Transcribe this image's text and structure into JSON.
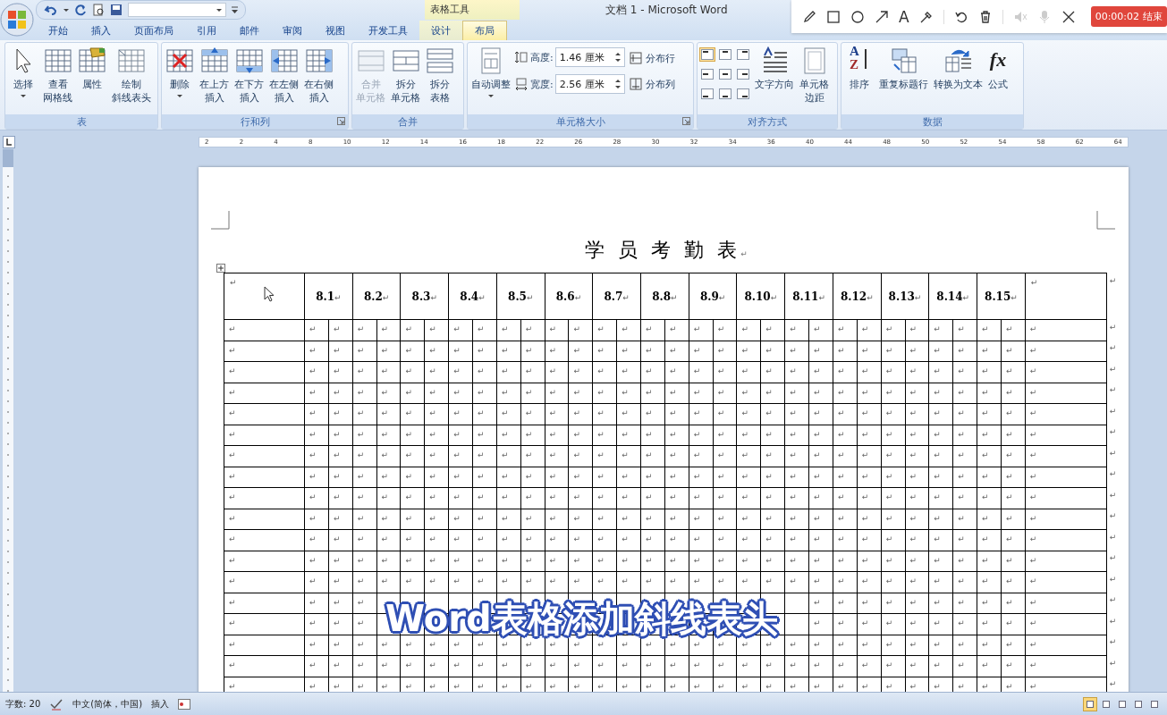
{
  "title_bar": {
    "context_label": "表格工具",
    "title": "文档 1 - Microsoft Word"
  },
  "tabs": [
    {
      "label": "开始",
      "selected": false
    },
    {
      "label": "插入",
      "selected": false
    },
    {
      "label": "页面布局",
      "selected": false
    },
    {
      "label": "引用",
      "selected": false
    },
    {
      "label": "邮件",
      "selected": false
    },
    {
      "label": "审阅",
      "selected": false
    },
    {
      "label": "视图",
      "selected": false
    },
    {
      "label": "开发工具",
      "selected": false
    },
    {
      "label": "设计",
      "selected": false
    },
    {
      "label": "布局",
      "selected": true
    }
  ],
  "ribbon": {
    "groups": [
      {
        "label": "表",
        "launcher": false,
        "items": [
          {
            "kind": "large",
            "lines": [
              "选择"
            ],
            "dropdown": true,
            "disabled": false
          },
          {
            "kind": "large",
            "lines": [
              "查看",
              "网格线"
            ],
            "dropdown": false,
            "disabled": false
          },
          {
            "kind": "large",
            "lines": [
              "属性"
            ],
            "dropdown": false,
            "disabled": false
          },
          {
            "kind": "large",
            "lines": [
              "绘制",
              "斜线表头"
            ],
            "dropdown": false,
            "disabled": false
          }
        ]
      },
      {
        "label": "行和列",
        "launcher": true,
        "items": [
          {
            "kind": "large",
            "lines": [
              "删除"
            ],
            "dropdown": true,
            "disabled": false
          },
          {
            "kind": "large",
            "lines": [
              "在上方",
              "插入"
            ],
            "dropdown": false,
            "disabled": false
          },
          {
            "kind": "large",
            "lines": [
              "在下方",
              "插入"
            ],
            "dropdown": false,
            "disabled": false
          },
          {
            "kind": "large",
            "lines": [
              "在左侧",
              "插入"
            ],
            "dropdown": false,
            "disabled": false
          },
          {
            "kind": "large",
            "lines": [
              "在右侧",
              "插入"
            ],
            "dropdown": false,
            "disabled": false
          }
        ]
      },
      {
        "label": "合并",
        "launcher": false,
        "items": [
          {
            "kind": "large",
            "lines": [
              "合并",
              "单元格"
            ],
            "dropdown": false,
            "disabled": true
          },
          {
            "kind": "large",
            "lines": [
              "拆分",
              "单元格"
            ],
            "dropdown": false,
            "disabled": false
          },
          {
            "kind": "large",
            "lines": [
              "拆分",
              "表格"
            ],
            "dropdown": false,
            "disabled": false
          }
        ]
      },
      {
        "label": "单元格大小",
        "launcher": true,
        "items": [
          {
            "kind": "large",
            "lines": [
              "自动调整"
            ],
            "dropdown": true,
            "disabled": false
          },
          {
            "kind": "size_fields",
            "fields": [
              {
                "label": "高度:",
                "value": "1.46 厘米"
              },
              {
                "label": "宽度:",
                "value": "2.56 厘米"
              }
            ]
          },
          {
            "kind": "small_stack",
            "buttons": [
              {
                "label": "分布行"
              },
              {
                "label": "分布列"
              }
            ]
          }
        ]
      },
      {
        "label": "对齐方式",
        "launcher": false,
        "items": [
          {
            "kind": "align_grid",
            "cells": [
              {
                "selected": true
              },
              {
                "selected": false
              },
              {
                "selected": false
              },
              {
                "selected": false
              },
              {
                "selected": false
              },
              {
                "selected": false
              },
              {
                "selected": false
              },
              {
                "selected": false
              },
              {
                "selected": false
              }
            ]
          },
          {
            "kind": "large",
            "lines": [
              "文字方向"
            ],
            "dropdown": false,
            "disabled": false
          },
          {
            "kind": "large",
            "lines": [
              "单元格",
              "边距"
            ],
            "dropdown": false,
            "disabled": false
          }
        ]
      },
      {
        "label": "数据",
        "launcher": false,
        "items": [
          {
            "kind": "large",
            "lines": [
              "排序"
            ],
            "glyph": [
              "A",
              "Z"
            ],
            "dropdown": false,
            "disabled": false
          },
          {
            "kind": "large",
            "lines": [
              "重复标题行"
            ],
            "dropdown": false,
            "disabled": false
          },
          {
            "kind": "large",
            "lines": [
              "转换为文本"
            ],
            "dropdown": false,
            "disabled": false
          },
          {
            "kind": "large",
            "lines": [
              "公式"
            ],
            "glyph": "fx",
            "dropdown": false,
            "disabled": false
          }
        ]
      }
    ]
  },
  "recorder": {
    "text_tool": "A",
    "timer": "00:00:02 结束"
  },
  "ruler": {
    "numbers": [
      "2",
      "2",
      "4",
      "8",
      "10",
      "12",
      "14",
      "16",
      "18",
      "22",
      "26",
      "28",
      "30",
      "32",
      "34",
      "36",
      "40",
      "44",
      "48",
      "50",
      "52",
      "54",
      "58",
      "62",
      "64"
    ]
  },
  "document": {
    "title": "学 员 考 勤 表",
    "title_mark": "↵",
    "table": {
      "header": {
        "corner": "↵",
        "dates": [
          {
            "text": "8.1",
            "mark": "↵"
          },
          {
            "text": "8.2",
            "mark": "↵"
          },
          {
            "text": "8.3",
            "mark": "↵"
          },
          {
            "text": "8.4",
            "mark": "↵"
          },
          {
            "text": "8.5",
            "mark": "↵"
          },
          {
            "text": "8.6",
            "mark": "↵"
          },
          {
            "text": "8.7",
            "mark": "↵"
          },
          {
            "text": "8.8",
            "mark": "↵"
          },
          {
            "text": "8.9",
            "mark": "↵"
          },
          {
            "text": "8.10",
            "mark": "↵"
          },
          {
            "text": "8.11",
            "mark": "↵"
          },
          {
            "text": "8.12",
            "mark": "↵"
          },
          {
            "text": "8.13",
            "mark": "↵"
          },
          {
            "text": "8.14",
            "mark": "↵"
          },
          {
            "text": "8.15",
            "mark": "↵"
          }
        ],
        "last": "↵",
        "end": "↵"
      },
      "rows": [
        [
          "↵",
          "↵",
          "↵",
          "↵",
          "↵",
          "↵",
          "↵",
          "↵",
          "↵",
          "↵",
          "↵",
          "↵",
          "↵",
          "↵",
          "↵",
          "↵",
          "↵",
          "↵",
          "↵",
          "↵",
          "↵",
          "↵",
          "↵",
          "↵",
          "↵",
          "↵",
          "↵",
          "↵",
          "↵",
          "↵",
          "↵",
          "↵",
          "↵"
        ],
        [
          "↵",
          "↵",
          "↵",
          "↵",
          "↵",
          "↵",
          "↵",
          "↵",
          "↵",
          "↵",
          "↵",
          "↵",
          "↵",
          "↵",
          "↵",
          "↵",
          "↵",
          "↵",
          "↵",
          "↵",
          "↵",
          "↵",
          "↵",
          "↵",
          "↵",
          "↵",
          "↵",
          "↵",
          "↵",
          "↵",
          "↵",
          "↵",
          "↵"
        ],
        [
          "↵",
          "↵",
          "↵",
          "↵",
          "↵",
          "↵",
          "↵",
          "↵",
          "↵",
          "↵",
          "↵",
          "↵",
          "↵",
          "↵",
          "↵",
          "↵",
          "↵",
          "↵",
          "↵",
          "↵",
          "↵",
          "↵",
          "↵",
          "↵",
          "↵",
          "↵",
          "↵",
          "↵",
          "↵",
          "↵",
          "↵",
          "↵",
          "↵"
        ],
        [
          "↵",
          "↵",
          "↵",
          "↵",
          "↵",
          "↵",
          "↵",
          "↵",
          "↵",
          "↵",
          "↵",
          "↵",
          "↵",
          "↵",
          "↵",
          "↵",
          "↵",
          "↵",
          "↵",
          "↵",
          "↵",
          "↵",
          "↵",
          "↵",
          "↵",
          "↵",
          "↵",
          "↵",
          "↵",
          "↵",
          "↵",
          "↵",
          "↵"
        ],
        [
          "↵",
          "↵",
          "↵",
          "↵",
          "↵",
          "↵",
          "↵",
          "↵",
          "↵",
          "↵",
          "↵",
          "↵",
          "↵",
          "↵",
          "↵",
          "↵",
          "↵",
          "↵",
          "↵",
          "↵",
          "↵",
          "↵",
          "↵",
          "↵",
          "↵",
          "↵",
          "↵",
          "↵",
          "↵",
          "↵",
          "↵",
          "↵",
          "↵"
        ],
        [
          "↵",
          "↵",
          "↵",
          "↵",
          "↵",
          "↵",
          "↵",
          "↵",
          "↵",
          "↵",
          "↵",
          "↵",
          "↵",
          "↵",
          "↵",
          "↵",
          "↵",
          "↵",
          "↵",
          "↵",
          "↵",
          "↵",
          "↵",
          "↵",
          "↵",
          "↵",
          "↵",
          "↵",
          "↵",
          "↵",
          "↵",
          "↵",
          "↵"
        ],
        [
          "↵",
          "↵",
          "↵",
          "↵",
          "↵",
          "↵",
          "↵",
          "↵",
          "↵",
          "↵",
          "↵",
          "↵",
          "↵",
          "↵",
          "↵",
          "↵",
          "↵",
          "↵",
          "↵",
          "↵",
          "↵",
          "↵",
          "↵",
          "↵",
          "↵",
          "↵",
          "↵",
          "↵",
          "↵",
          "↵",
          "↵",
          "↵",
          "↵"
        ],
        [
          "↵",
          "↵",
          "↵",
          "↵",
          "↵",
          "↵",
          "↵",
          "↵",
          "↵",
          "↵",
          "↵",
          "↵",
          "↵",
          "↵",
          "↵",
          "↵",
          "↵",
          "↵",
          "↵",
          "↵",
          "↵",
          "↵",
          "↵",
          "↵",
          "↵",
          "↵",
          "↵",
          "↵",
          "↵",
          "↵",
          "↵",
          "↵",
          "↵"
        ],
        [
          "↵",
          "↵",
          "↵",
          "↵",
          "↵",
          "↵",
          "↵",
          "↵",
          "↵",
          "↵",
          "↵",
          "↵",
          "↵",
          "↵",
          "↵",
          "↵",
          "↵",
          "↵",
          "↵",
          "↵",
          "↵",
          "↵",
          "↵",
          "↵",
          "↵",
          "↵",
          "↵",
          "↵",
          "↵",
          "↵",
          "↵",
          "↵",
          "↵"
        ],
        [
          "↵",
          "↵",
          "↵",
          "↵",
          "↵",
          "↵",
          "↵",
          "↵",
          "↵",
          "↵",
          "↵",
          "↵",
          "↵",
          "↵",
          "↵",
          "↵",
          "↵",
          "↵",
          "↵",
          "↵",
          "↵",
          "↵",
          "↵",
          "↵",
          "↵",
          "↵",
          "↵",
          "↵",
          "↵",
          "↵",
          "↵",
          "↵",
          "↵"
        ],
        [
          "↵",
          "↵",
          "↵",
          "↵",
          "↵",
          "↵",
          "↵",
          "↵",
          "↵",
          "↵",
          "↵",
          "↵",
          "↵",
          "↵",
          "↵",
          "↵",
          "↵",
          "↵",
          "↵",
          "↵",
          "↵",
          "↵",
          "↵",
          "↵",
          "↵",
          "↵",
          "↵",
          "↵",
          "↵",
          "↵",
          "↵",
          "↵",
          "↵"
        ],
        [
          "↵",
          "↵",
          "↵",
          "↵",
          "↵",
          "↵",
          "↵",
          "↵",
          "↵",
          "↵",
          "↵",
          "↵",
          "↵",
          "↵",
          "↵",
          "↵",
          "↵",
          "↵",
          "↵",
          "↵",
          "↵",
          "↵",
          "↵",
          "↵",
          "↵",
          "↵",
          "↵",
          "↵",
          "↵",
          "↵",
          "↵",
          "↵",
          "↵"
        ],
        [
          "↵",
          "↵",
          "↵",
          "↵",
          "↵",
          "↵",
          "↵",
          "↵",
          "↵",
          "↵",
          "↵",
          "↵",
          "↵",
          "↵",
          "↵",
          "↵",
          "↵",
          "↵",
          "↵",
          "↵",
          "↵",
          "↵",
          "↵",
          "↵",
          "↵",
          "↵",
          "↵",
          "↵",
          "↵",
          "↵",
          "↵",
          "↵",
          "↵"
        ],
        [
          "↵",
          "↵",
          "↵",
          "↵",
          null,
          null,
          null,
          null,
          null,
          null,
          null,
          null,
          null,
          null,
          null,
          null,
          null,
          null,
          null,
          null,
          null,
          null,
          "↵",
          "↵",
          "↵",
          "↵",
          "↵",
          "↵",
          "↵",
          "↵",
          "↵",
          "↵",
          "↵"
        ],
        [
          "↵",
          "↵",
          "↵",
          "↵",
          null,
          null,
          null,
          null,
          null,
          null,
          null,
          null,
          null,
          null,
          null,
          null,
          null,
          null,
          null,
          null,
          null,
          null,
          "↵",
          "↵",
          "↵",
          "↵",
          "↵",
          "↵",
          "↵",
          "↵",
          "↵",
          "↵",
          "↵"
        ],
        [
          "↵",
          "↵",
          "↵",
          "↵",
          "↵",
          "↵",
          "↵",
          "↵",
          "↵",
          "↵",
          "↵",
          "↵",
          "↵",
          "↵",
          "↵",
          "↵",
          "↵",
          "↵",
          "↵",
          "↵",
          "↵",
          "↵",
          "↵",
          "↵",
          "↵",
          "↵",
          "↵",
          "↵",
          "↵",
          "↵",
          "↵",
          "↵",
          "↵"
        ],
        [
          "↵",
          "↵",
          "↵",
          "↵",
          "↵",
          "↵",
          "↵",
          "↵",
          "↵",
          "↵",
          "↵",
          "↵",
          "↵",
          "↵",
          "↵",
          "↵",
          "↵",
          "↵",
          "↵",
          "↵",
          "↵",
          "↵",
          "↵",
          "↵",
          "↵",
          "↵",
          "↵",
          "↵",
          "↵",
          "↵",
          "↵",
          "↵",
          "↵"
        ],
        [
          "↵",
          "↵",
          "↵",
          "↵",
          "↵",
          "↵",
          "↵",
          "↵",
          "↵",
          "↵",
          "↵",
          "↵",
          "↵",
          "↵",
          "↵",
          "↵",
          "↵",
          "↵",
          "↵",
          "↵",
          "↵",
          "↵",
          "↵",
          "↵",
          "↵",
          "↵",
          "↵",
          "↵",
          "↵",
          "↵",
          "↵",
          "↵",
          "↵"
        ]
      ]
    }
  },
  "caption": "Word表格添加斜线表头",
  "status_bar": {
    "word_count": "字数: 20",
    "language": "中文(简体，中国)",
    "mode": "插入",
    "views": [
      {
        "selected": true
      },
      {
        "selected": false
      },
      {
        "selected": false
      },
      {
        "selected": false
      },
      {
        "selected": false
      }
    ]
  }
}
